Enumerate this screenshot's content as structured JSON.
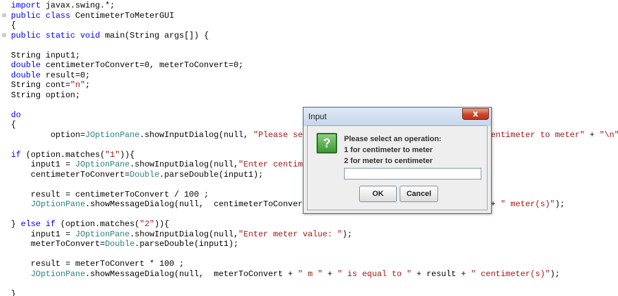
{
  "editor": {
    "lines": [
      {
        "fold": "",
        "text": "import javax.swing.*;"
      },
      {
        "fold": "⊟",
        "text": "public class CentimeterToMeterGUI"
      },
      {
        "fold": "",
        "text": "{"
      },
      {
        "fold": "⊟",
        "text": "public static void main(String args[]) {"
      },
      {
        "fold": "",
        "text": ""
      },
      {
        "fold": "",
        "text": "String input1;"
      },
      {
        "fold": "",
        "text": "double centimeterToConvert=0, meterToConvert=0;"
      },
      {
        "fold": "",
        "text": "double result=0;"
      },
      {
        "fold": "",
        "text": "String cont=\"n\";"
      },
      {
        "fold": "",
        "text": "String option;"
      },
      {
        "fold": "",
        "text": ""
      },
      {
        "fold": "",
        "text": "do"
      },
      {
        "fold": "",
        "text": "{"
      },
      {
        "fold": "",
        "text": "        option=JOptionPane.showInputDialog(null, \"Please select an operation: \" + \"\\n\" + \"1 for centimeter to meter\" + \"\\n\""
      },
      {
        "fold": "",
        "text": ""
      },
      {
        "fold": "",
        "text": "if (option.matches(\"1\")){"
      },
      {
        "fold": "",
        "text": "    input1 = JOptionPane.showInputDialog(null,\"Enter centimeter value: \");"
      },
      {
        "fold": "",
        "text": "    centimeterToConvert=Double.parseDouble(input1);"
      },
      {
        "fold": "",
        "text": ""
      },
      {
        "fold": "",
        "text": "    result = centimeterToConvert / 100 ;"
      },
      {
        "fold": "",
        "text": "    JOptionPane.showMessageDialog(null,  centimeterToConvert + \" cm \" + \" is equal to \" + result + \" meter(s)\");"
      },
      {
        "fold": "",
        "text": ""
      },
      {
        "fold": "",
        "text": "} else if (option.matches(\"2\")){"
      },
      {
        "fold": "",
        "text": "    input1 = JOptionPane.showInputDialog(null,\"Enter meter value: \");"
      },
      {
        "fold": "",
        "text": "    meterToConvert=Double.parseDouble(input1);"
      },
      {
        "fold": "",
        "text": ""
      },
      {
        "fold": "",
        "text": "    result = meterToConvert * 100 ;"
      },
      {
        "fold": "",
        "text": "    JOptionPane.showMessageDialog(null,  meterToConvert + \" m \" + \" is equal to \" + result + \" centimeter(s)\");"
      },
      {
        "fold": "",
        "text": ""
      },
      {
        "fold": "",
        "text": "}"
      }
    ]
  },
  "dialog": {
    "title": "Input",
    "close_label": "x",
    "icon_glyph": "?",
    "message_lines": [
      "Please select an operation:",
      "1 for centimeter to meter",
      "2 for meter to centimeter"
    ],
    "input_value": "",
    "ok_label": "OK",
    "cancel_label": "Cancel"
  },
  "colors": {
    "keyword": "#0000ff",
    "string": "#a31515",
    "class": "#2b8080",
    "dialog_title_bar": "#c6d6ea",
    "close_button": "#c9452a",
    "question_icon": "#3c9a36"
  },
  "icons": {
    "dialog": "question-icon",
    "close": "close-icon"
  }
}
